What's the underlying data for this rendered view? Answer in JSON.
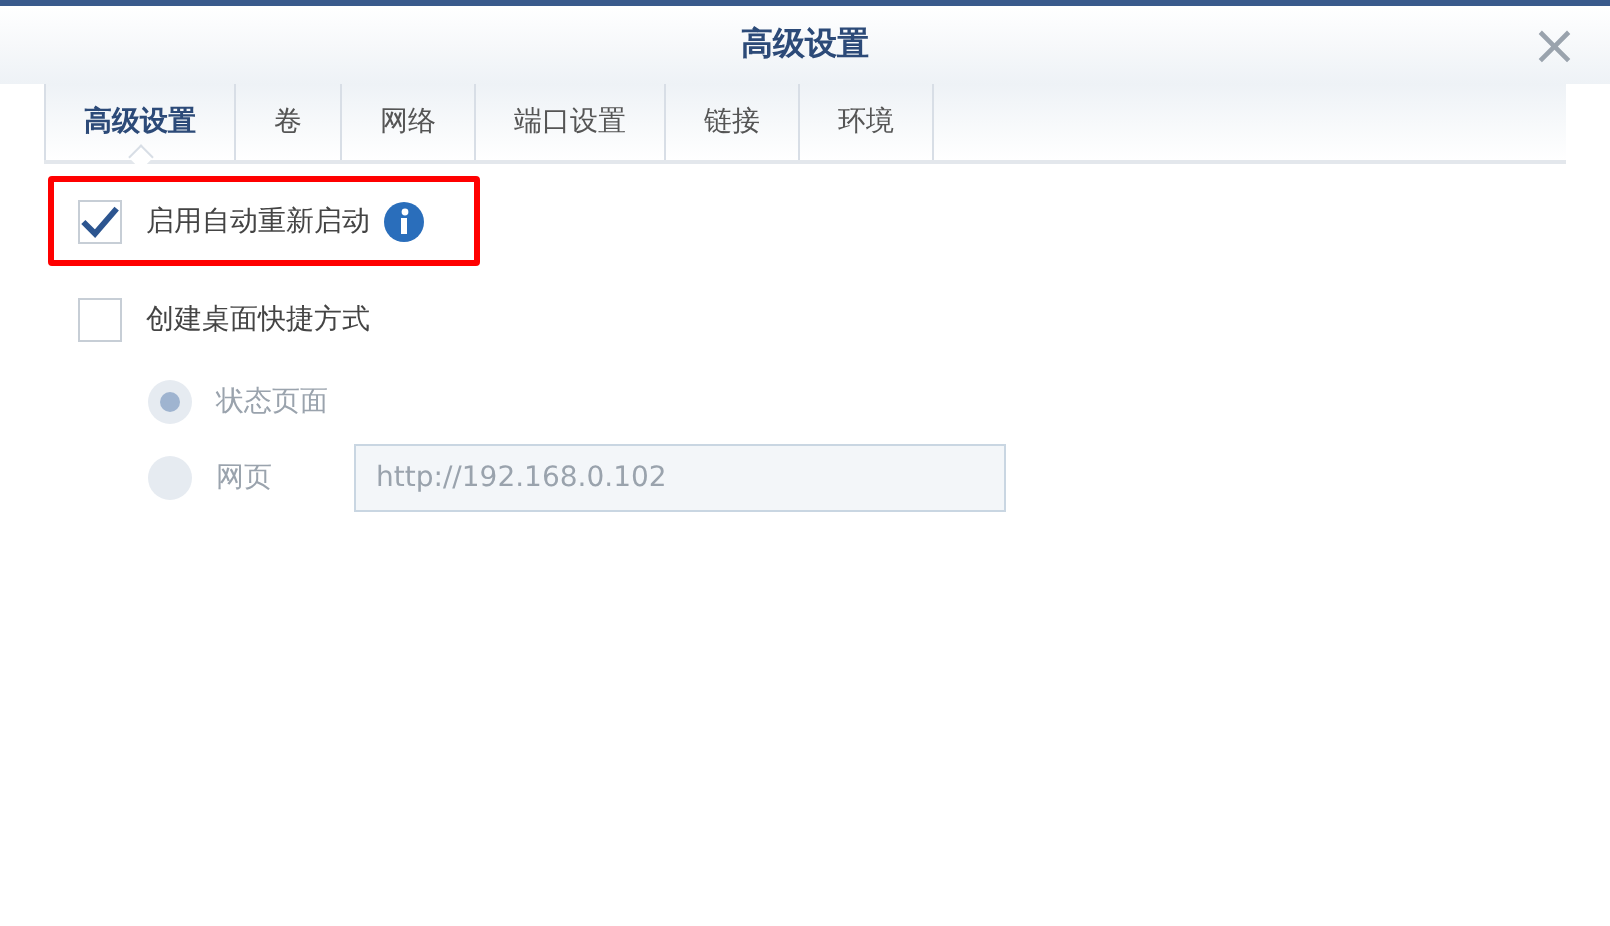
{
  "window": {
    "title": "高级设置",
    "close": "×"
  },
  "tabs": [
    {
      "label": "高级设置",
      "selected": true
    },
    {
      "label": "卷",
      "selected": false
    },
    {
      "label": "网络",
      "selected": false
    },
    {
      "label": "端口设置",
      "selected": false
    },
    {
      "label": "链接",
      "selected": false
    },
    {
      "label": "环境",
      "selected": false
    }
  ],
  "options": [
    {
      "label": "启用自动重新启动",
      "checked": true,
      "info": true,
      "highlighted": true
    },
    {
      "label": "创建桌面快捷方式",
      "checked": false,
      "info": false,
      "highlighted": false
    }
  ],
  "shortcut_targets": [
    {
      "label": "状态页面",
      "selected": true,
      "disabled": true
    },
    {
      "label": "网页",
      "selected": false,
      "disabled": true,
      "value": "http://192.168.0.102"
    }
  ]
}
